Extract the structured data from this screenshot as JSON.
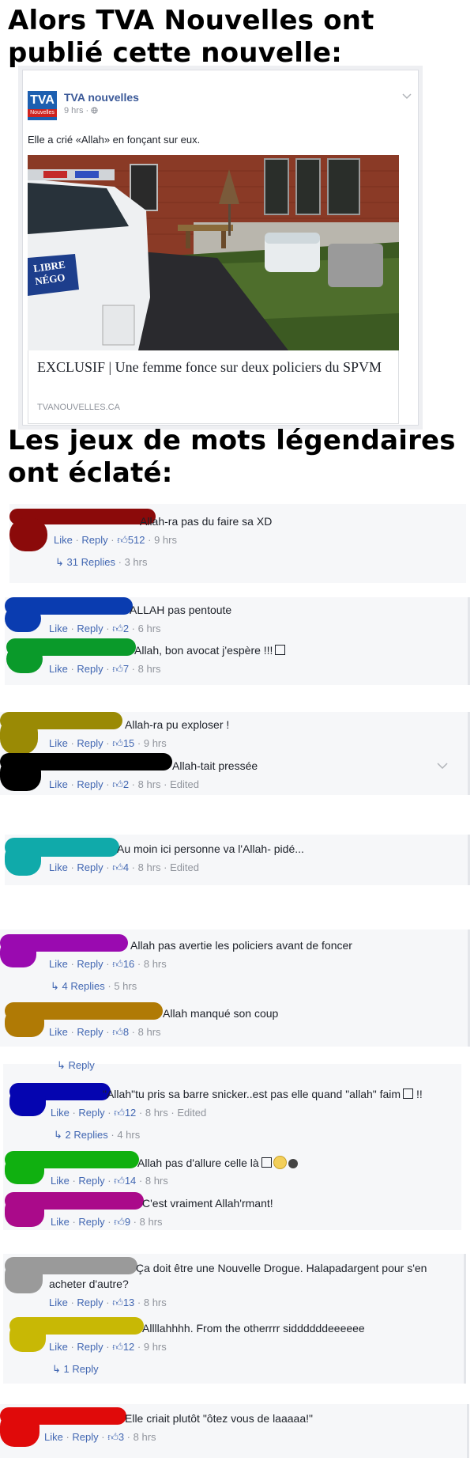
{
  "headline_1": [
    "Alors TVA Nouvelles ont",
    "publié cette nouvelle:"
  ],
  "headline_2": [
    "Les jeux de mots légendaires",
    "ont éclaté:"
  ],
  "post": {
    "logo_text": "TVA",
    "logo_strip": "Nouvelles",
    "page_name": "TVA nouvelles",
    "time": "9 hrs · ",
    "globe_icon": "globe-icon",
    "body": "Elle a crié «Allah» en fonçant sur eux.",
    "photo_sticker": [
      "LIBRE",
      "NÉGO"
    ],
    "link_title": "EXCLUSIF | Une femme fonce sur deux policiers du SPVM",
    "link_domain": "TVANOUVELLES.CA"
  },
  "action_like": "Like",
  "action_reply": "Reply",
  "comments": {
    "c1": {
      "text": "Allah-ra pas du faire sa XD",
      "likes": "512",
      "time": "9 hrs",
      "replies": "31 Replies",
      "replies_time": "3 hrs"
    },
    "c2": {
      "text": "ALLAH pas pentoute",
      "likes": "2",
      "time": "6 hrs"
    },
    "c3": {
      "text": "Allah, bon avocat j'espère !!!",
      "likes": "7",
      "time": "8 hrs"
    },
    "c4": {
      "text": "Allah-ra pu exploser !",
      "likes": "15",
      "time": "9 hrs"
    },
    "c5": {
      "text": "Allah-tait pressée",
      "likes": "2",
      "time": "8 hrs",
      "edited": "Edited"
    },
    "c6": {
      "text": "Au moin ici personne va l'Allah- pidé...",
      "likes": "4",
      "time": "8 hrs",
      "edited": "Edited"
    },
    "c7": {
      "text": "Allah pas avertie les policiers avant de foncer",
      "likes": "16",
      "time": "8 hrs",
      "replies": "4 Replies",
      "replies_time": "5 hrs"
    },
    "c8": {
      "text": "Allah manqué son coup",
      "likes": "8",
      "time": "8 hrs"
    },
    "c9": {
      "text": "\"Allah\"tu pris sa barre snicker..est pas elle quand \"allah\" faim",
      "text_end": "!!",
      "likes": "12",
      "time": "8 hrs",
      "edited": "Edited",
      "replies": "2 Replies",
      "replies_time": "4 hrs"
    },
    "c10": {
      "text": "Allah pas d'allure celle là",
      "likes": "14",
      "time": "8 hrs"
    },
    "c11": {
      "text": "C'est vraiment Allah'rmant!",
      "likes": "9",
      "time": "8 hrs"
    },
    "c12": {
      "text": "Ça doit être une Nouvelle Drogue. Halapadargent pour s'en",
      "text_2": "acheter d'autre?",
      "likes": "13",
      "time": "8 hrs"
    },
    "c13": {
      "text": "Allllahhhh. From the otherrrr siddddddeeeeee",
      "likes": "12",
      "time": "9 hrs",
      "replies": "1 Reply"
    },
    "c14": {
      "text": "Elle criait plutôt \"ôtez vous de laaaaa!\"",
      "likes": "3",
      "time": "8 hrs"
    }
  },
  "partial_reply_text": "Reply",
  "colors": {
    "link_blue": "#4267b2",
    "meta_gray": "#90949c",
    "panel_bg": "#f6f7f9",
    "blot_dark_red": "#8b0a0a",
    "blot_blue": "#0a3cb0",
    "blot_green": "#0a9a2a",
    "blot_olive": "#9a8a05",
    "blot_black": "#000000",
    "blot_teal": "#10aaaa",
    "blot_purple": "#9a0ab0",
    "blot_orange": "#b07a05",
    "blot_navy": "#0505b0",
    "blot_lime": "#10b010",
    "blot_magenta": "#aa0a8a",
    "blot_gray": "#9a9a9a",
    "blot_yellow": "#c8b805",
    "blot_red": "#e00a0a"
  }
}
